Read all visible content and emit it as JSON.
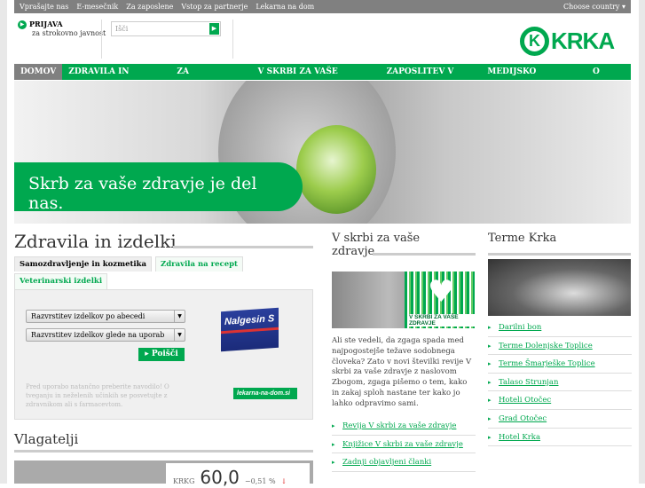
{
  "topbar": {
    "links": [
      "Vprašajte nas",
      "E-mesečnik",
      "Za zaposlene",
      "Vstop za partnerje",
      "Lekarna na dom"
    ],
    "country": "Choose country ▾"
  },
  "login": {
    "title": "PRIJAVA",
    "sub": "za strokovno javnost"
  },
  "search": {
    "placeholder": "Išči"
  },
  "logo": {
    "text": "KRKA"
  },
  "nav": [
    "DOMOV",
    "ZDRAVILA IN IZDELKI",
    "ZA VLAGATELJE",
    "V SKRBI ZA VAŠE ZDRAVJE",
    "ZAPOSLITEV V KRKI",
    "MEDIJSKO SREDIŠČE",
    "O KRKI"
  ],
  "hero": {
    "slogan": "Skrb za vaše zdravje je del nas."
  },
  "products": {
    "title": "Zdravila in izdelki",
    "tabs": [
      "Samozdravljenje in kozmetika",
      "Zdravila na recept",
      "Veterinarski izdelki"
    ],
    "select1": "Razvrstitev izdelkov po abecedi",
    "select2": "Razvrstitev izdelkov glede na uporab",
    "search_button": "Poišči",
    "note": "Pred uporabo natančno preberite navodilo! O tveganju in neželenih učinkih se posvetujte z zdravnikom ali s farmacevtom.",
    "product_name": "Nalgesin S",
    "pharmacy_link": "lekarna-na-dom.si"
  },
  "investors": {
    "title": "Vlagatelji",
    "ticker": "KRKG",
    "price": "60,0",
    "change": "−0,51 %",
    "arrow": "↓"
  },
  "care": {
    "title": "V skrbi za vaše zdravje",
    "banner": "V SKRBI ZA VAŠE ZDRAVJE",
    "text": "Ali ste vedeli, da zgaga spada med najpogostejše težave sodobnega človeka? Zato v novi številki revije V skrbi za vaše zdravje z naslovom Zbogom, zgaga pišemo o tem, kako in zakaj sploh nastane ter kako jo lahko odpravimo sami.",
    "links": [
      "Revija V skrbi za vaše zdravje",
      "Knjižice V skrbi za vaše zdravje",
      "Zadnji objavljeni članki"
    ]
  },
  "terme": {
    "title": "Terme Krka",
    "links": [
      "Darilni bon",
      "Terme Dolenjske Toplice",
      "Terme Šmarješke Toplice",
      "Talaso Strunjan",
      "Hoteli Otočec",
      "Grad Otočec",
      "Hotel Krka"
    ]
  },
  "colors": {
    "brand": "#00a84f",
    "nav_active": "#808080"
  }
}
